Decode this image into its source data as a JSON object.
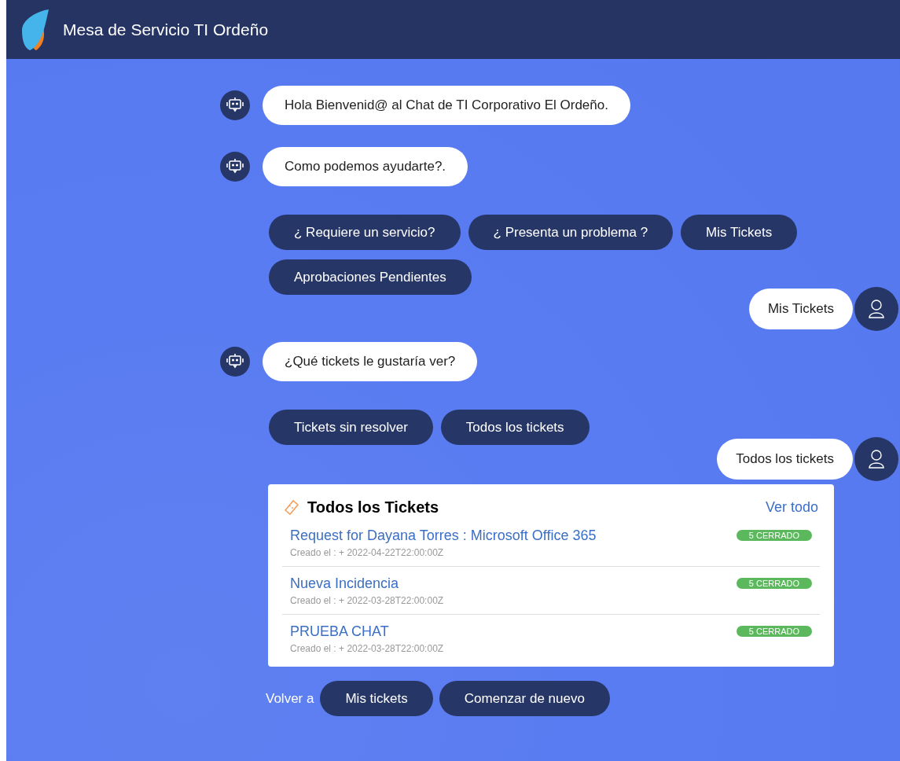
{
  "header": {
    "title": "Mesa de Servicio TI Ordeño"
  },
  "messages": [
    {
      "kind": "bot",
      "text": "Hola Bienvenid@ al Chat de TI Corporativo El Ordeño."
    },
    {
      "kind": "bot",
      "text": "Como podemos ayudarte?."
    },
    {
      "kind": "options",
      "options": [
        "¿ Requiere un servicio?",
        "¿ Presenta un problema ?",
        "Mis Tickets",
        "Aprobaciones Pendientes"
      ]
    },
    {
      "kind": "user",
      "text": "Mis Tickets"
    },
    {
      "kind": "bot",
      "text": "¿Qué tickets le gustaría ver?"
    },
    {
      "kind": "options",
      "options": [
        "Tickets sin resolver",
        "Todos los tickets"
      ]
    },
    {
      "kind": "user",
      "text": "Todos los tickets"
    },
    {
      "kind": "tickets",
      "title": "Todos los Tickets",
      "link": "Ver todo",
      "tickets": [
        {
          "title": "Request for Dayana Torres : Microsoft Office 365",
          "created": "Creado el : + 2022-04-22T22:00:00Z",
          "status": "5 CERRADO"
        },
        {
          "title": "Nueva Incidencia",
          "created": "Creado el : + 2022-03-28T22:00:00Z",
          "status": "5 CERRADO"
        },
        {
          "title": "PRUEBA CHAT",
          "created": "Creado el : + 2022-03-28T22:00:00Z",
          "status": "5 CERRADO"
        }
      ]
    },
    {
      "kind": "footer",
      "label": "Volver a",
      "options": [
        "Mis tickets",
        "Comenzar de nuevo"
      ]
    }
  ]
}
